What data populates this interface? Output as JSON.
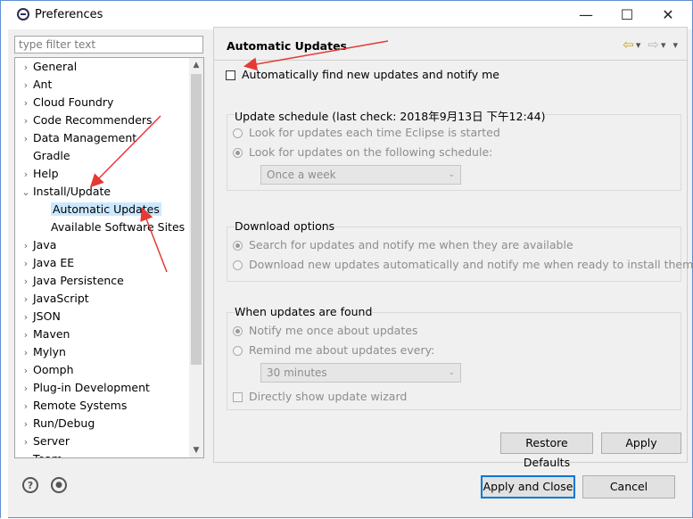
{
  "window": {
    "title": "Preferences",
    "minimize": "—",
    "maximize": "☐",
    "close": "✕"
  },
  "filter": {
    "placeholder": "type filter text"
  },
  "tree": {
    "items": [
      {
        "label": "General",
        "arrow": "›"
      },
      {
        "label": "Ant",
        "arrow": "›"
      },
      {
        "label": "Cloud Foundry",
        "arrow": "›"
      },
      {
        "label": "Code Recommenders",
        "arrow": "›"
      },
      {
        "label": "Data Management",
        "arrow": "›"
      },
      {
        "label": "Gradle",
        "arrow": ""
      },
      {
        "label": "Help",
        "arrow": "›"
      },
      {
        "label": "Install/Update",
        "arrow": "⌄"
      },
      {
        "label": "Automatic Updates",
        "arrow": ""
      },
      {
        "label": "Available Software Sites",
        "arrow": ""
      },
      {
        "label": "Java",
        "arrow": "›"
      },
      {
        "label": "Java EE",
        "arrow": "›"
      },
      {
        "label": "Java Persistence",
        "arrow": "›"
      },
      {
        "label": "JavaScript",
        "arrow": "›"
      },
      {
        "label": "JSON",
        "arrow": "›"
      },
      {
        "label": "Maven",
        "arrow": "›"
      },
      {
        "label": "Mylyn",
        "arrow": "›"
      },
      {
        "label": "Oomph",
        "arrow": "›"
      },
      {
        "label": "Plug-in Development",
        "arrow": "›"
      },
      {
        "label": "Remote Systems",
        "arrow": "›"
      },
      {
        "label": "Run/Debug",
        "arrow": "›"
      },
      {
        "label": "Server",
        "arrow": "›"
      },
      {
        "label": "Team",
        "arrow": "›"
      }
    ],
    "selected": "Automatic Updates"
  },
  "page": {
    "title": "Automatic Updates",
    "auto_find": {
      "label": "Automatically find new updates and notify me",
      "checked": false
    },
    "schedule": {
      "title": "Update schedule (last check: 2018年9月13日 下午12:44)",
      "option1": "Look for updates each time Eclipse is started",
      "option2": "Look for updates on the following schedule:",
      "selected_option": 2,
      "frequency": "Once a week"
    },
    "download": {
      "title": "Download options",
      "option1": "Search for updates and notify me when they are available",
      "option2": "Download new updates automatically and notify me when ready to install them",
      "selected_option": 1
    },
    "found": {
      "title": "When updates are found",
      "option1": "Notify me once about updates",
      "option2": "Remind me about updates every:",
      "selected_option": 1,
      "interval": "30 minutes",
      "wizard": "Directly show update wizard",
      "wizard_checked": false
    }
  },
  "buttons": {
    "restore_defaults": "Restore Defaults",
    "apply": "Apply",
    "apply_and_close": "Apply and Close",
    "cancel": "Cancel"
  },
  "footer": {
    "help_icon": "?",
    "import_export_icon": "●"
  },
  "colors": {
    "selection": "#cce8ff",
    "accent": "#0078d7",
    "annotation_arrow": "#e53935"
  }
}
